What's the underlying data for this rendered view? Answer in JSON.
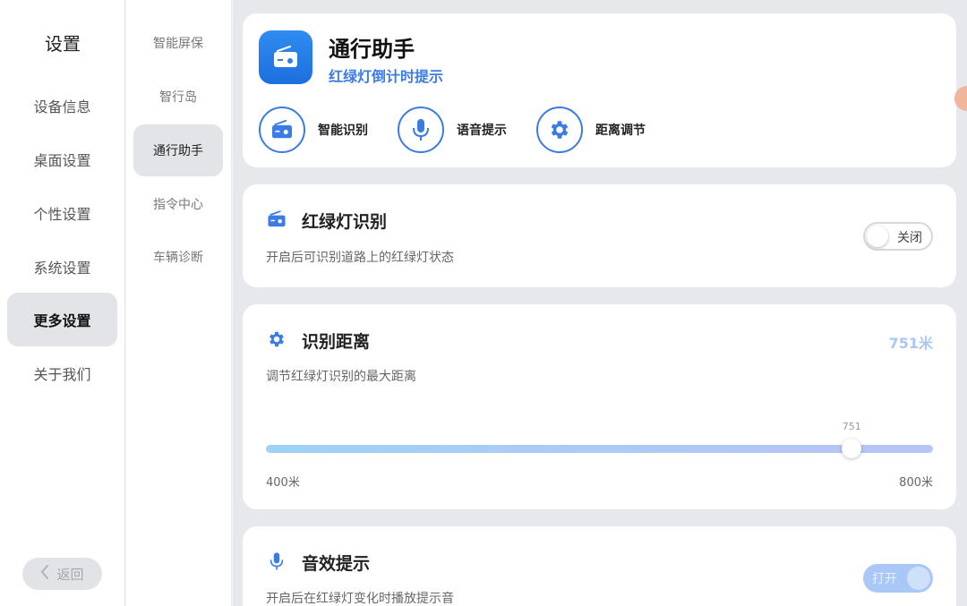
{
  "left_nav": {
    "title": "设置",
    "items": [
      "设备信息",
      "桌面设置",
      "个性设置",
      "系统设置",
      "更多设置",
      "关于我们"
    ],
    "active_index": 4,
    "back_label": "返回"
  },
  "sub_nav": {
    "items": [
      "智能屏保",
      "智行岛",
      "通行助手",
      "指令中心",
      "车辆诊断"
    ],
    "active_index": 2
  },
  "header_card": {
    "app_title": "通行助手",
    "app_subtitle": "红绿灯倒计时提示",
    "features": [
      {
        "label": "智能识别",
        "icon": "radio-icon"
      },
      {
        "label": "语音提示",
        "icon": "microphone-icon"
      },
      {
        "label": "距离调节",
        "icon": "gear-icon"
      }
    ]
  },
  "traffic_light_card": {
    "title": "红绿灯识别",
    "description": "开启后可识别道路上的红绿灯状态",
    "toggle_state": "off",
    "toggle_label": "关闭",
    "icon": "radio-icon"
  },
  "distance_card": {
    "title": "识别距离",
    "description": "调节红绿灯识别的最大距离",
    "value_label": "751米",
    "slider": {
      "min": 400,
      "max": 800,
      "value": 751,
      "tip": "751",
      "min_label": "400米",
      "max_label": "800米"
    },
    "icon": "gear-icon"
  },
  "sound_card": {
    "title": "音效提示",
    "description": "开启后在红绿灯变化时播放提示音",
    "toggle_state": "on",
    "toggle_label": "打开",
    "icon": "microphone-icon"
  },
  "colors": {
    "accent": "#3a7be4",
    "active_nav_bg": "#e3e4e8",
    "content_bg": "#e6e8ec"
  }
}
